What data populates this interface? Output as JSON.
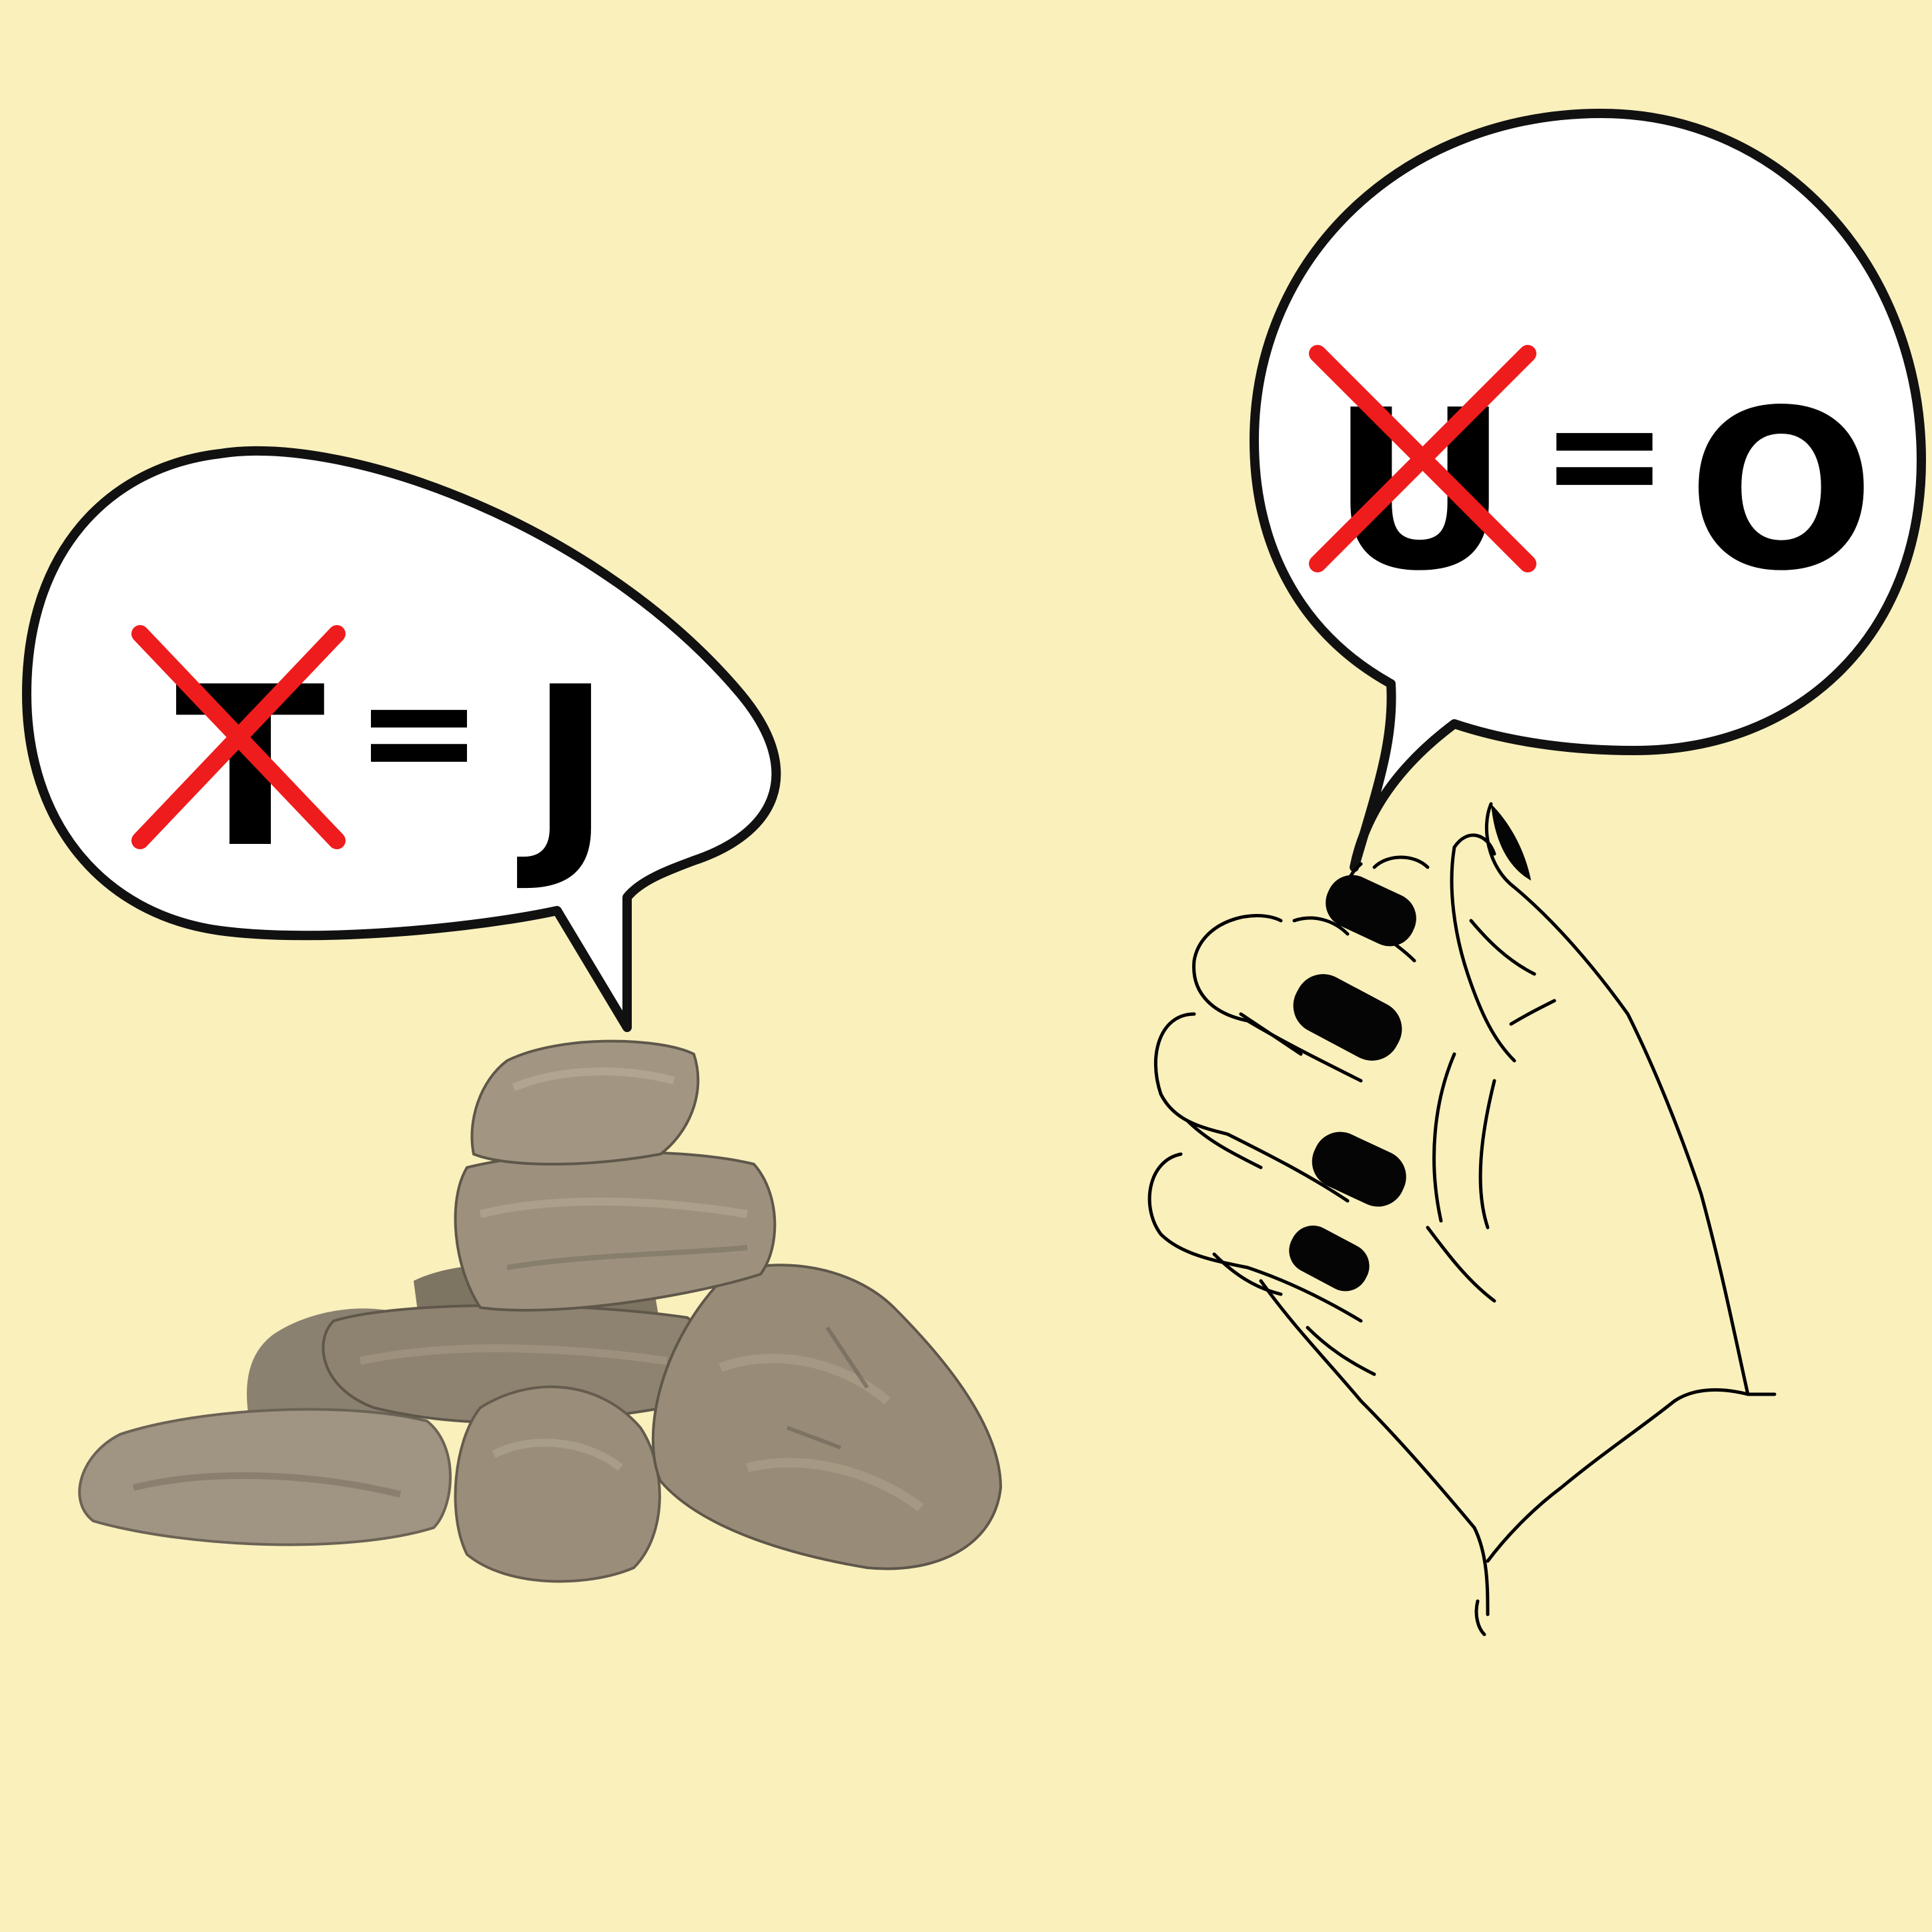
{
  "colors": {
    "background": "#f9f0bc",
    "bubble_fill": "#ffffff",
    "outline": "#111111",
    "cross": "#ee1c1c",
    "rock_light": "#a89a82",
    "rock_mid": "#8c7f6a",
    "rock_dark": "#5f574a",
    "nail": "#050505"
  },
  "left_bubble": {
    "crossed_letter": "T",
    "equals": "=",
    "result_letter": "J"
  },
  "right_bubble": {
    "crossed_letter": "U",
    "equals": "=",
    "result_letter": "O"
  },
  "icons": {
    "rocks": "rock-pile-icon",
    "hand": "hand-icon",
    "cross": "cross-out-icon"
  }
}
